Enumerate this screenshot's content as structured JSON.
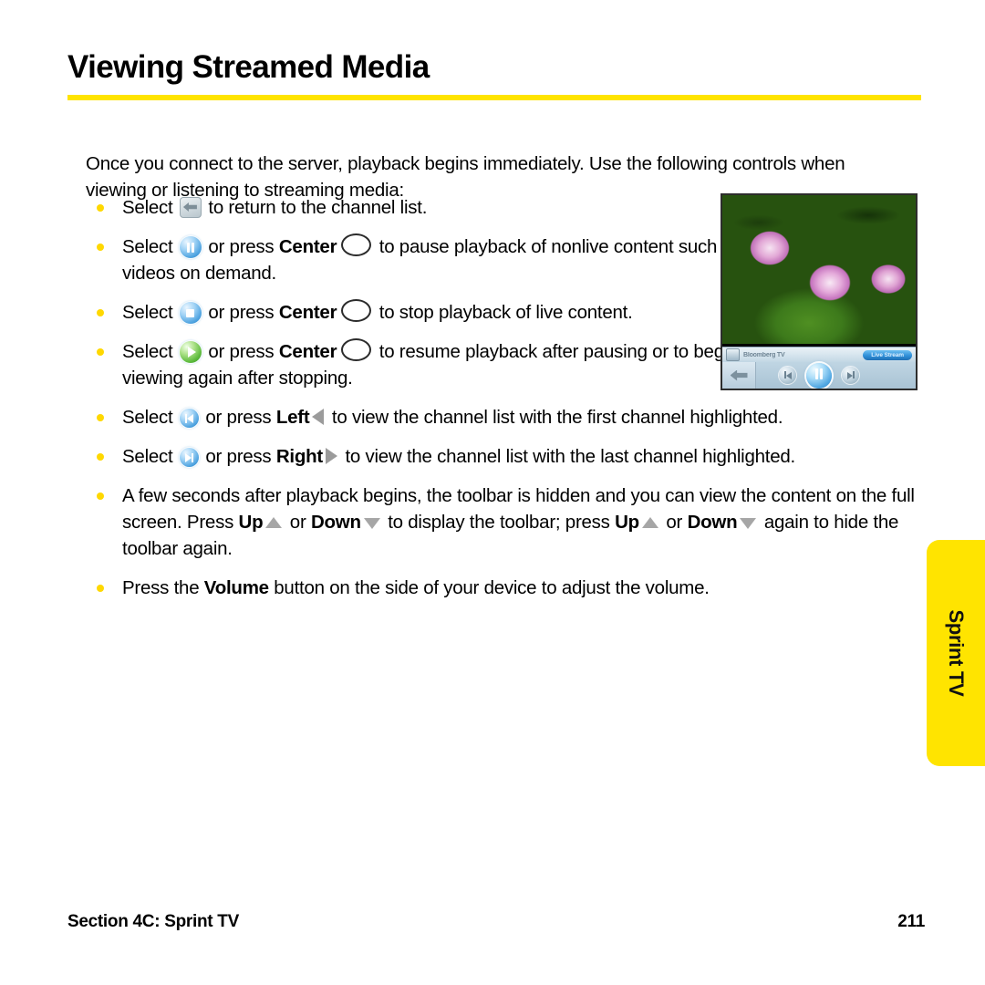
{
  "page": {
    "title": "Viewing Streamed Media",
    "intro": "Once you connect to the server, playback begins immediately. Use the following controls when viewing or listening to streaming media:",
    "accent_yellow": "#ffe400",
    "bullet_dot_color": "#ffd800"
  },
  "bullets": [
    {
      "id": "return-to-channel-list",
      "parts": {
        "p1": "Select ",
        "icon": "back-arrow-icon",
        "p2": " to return to the channel list."
      }
    },
    {
      "id": "pause-playback",
      "parts": {
        "p1": "Select ",
        "icon": "pause-icon",
        "p2": " or press ",
        "key": "Center",
        "key_icon": "center-key-icon",
        "p3": " to pause playback of nonlive content such as videos on demand."
      }
    },
    {
      "id": "stop-playback",
      "parts": {
        "p1": "Select ",
        "icon": "stop-icon",
        "p2": " or press ",
        "key": "Center",
        "key_icon": "center-key-icon",
        "p3": " to stop playback of live content."
      }
    },
    {
      "id": "resume-playback",
      "parts": {
        "p1": "Select ",
        "icon": "play-icon",
        "p2": " or press ",
        "key": "Center",
        "key_icon": "center-key-icon",
        "p3": " to resume playback after pausing or to begin viewing again after stopping."
      }
    },
    {
      "id": "first-channel",
      "parts": {
        "p1": "Select ",
        "icon": "skip-previous-icon",
        "p2": " or press ",
        "key": "Left",
        "key_icon": "triangle-left-icon",
        "p3": " to view the channel list with the first channel highlighted."
      }
    },
    {
      "id": "last-channel",
      "parts": {
        "p1": "Select ",
        "icon": "skip-next-icon",
        "p2": " or press ",
        "key": "Right",
        "key_icon": "triangle-right-icon",
        "p3": " to view the channel list with the last channel highlighted."
      }
    },
    {
      "id": "toolbar-visibility",
      "parts": {
        "p1": "A few seconds after playback begins, the toolbar is hidden and you can view the content on the full screen. Press ",
        "key1": "Up",
        "key1_icon": "triangle-up-icon",
        "p2": " or ",
        "key2": "Down",
        "key2_icon": "triangle-down-icon",
        "p3": " to display the toolbar; press ",
        "key3": "Up",
        "key3_icon": "triangle-up-icon",
        "p4": " or ",
        "key4": "Down",
        "key4_icon": "triangle-down-icon",
        "p5": " again to hide the toolbar again."
      }
    },
    {
      "id": "volume-button",
      "parts": {
        "p1": "Press the ",
        "key": "Volume",
        "p2": " button on the side of your device to adjust the volume."
      }
    }
  ],
  "figure": {
    "alt": "phone-screen-streaming-video",
    "photo_description": "pink water lilies on green lily pads",
    "player": {
      "channel_name": "Bloomberg TV",
      "live_pill_label": "Live Stream",
      "back_icon": "back-arrow-icon",
      "prev_icon": "skip-previous-icon",
      "pause_icon": "pause-icon",
      "next_icon": "skip-next-icon"
    }
  },
  "side_tab": {
    "label": "Sprint TV"
  },
  "footer": {
    "section": "Section 4C: Sprint TV",
    "page_number": "211"
  }
}
